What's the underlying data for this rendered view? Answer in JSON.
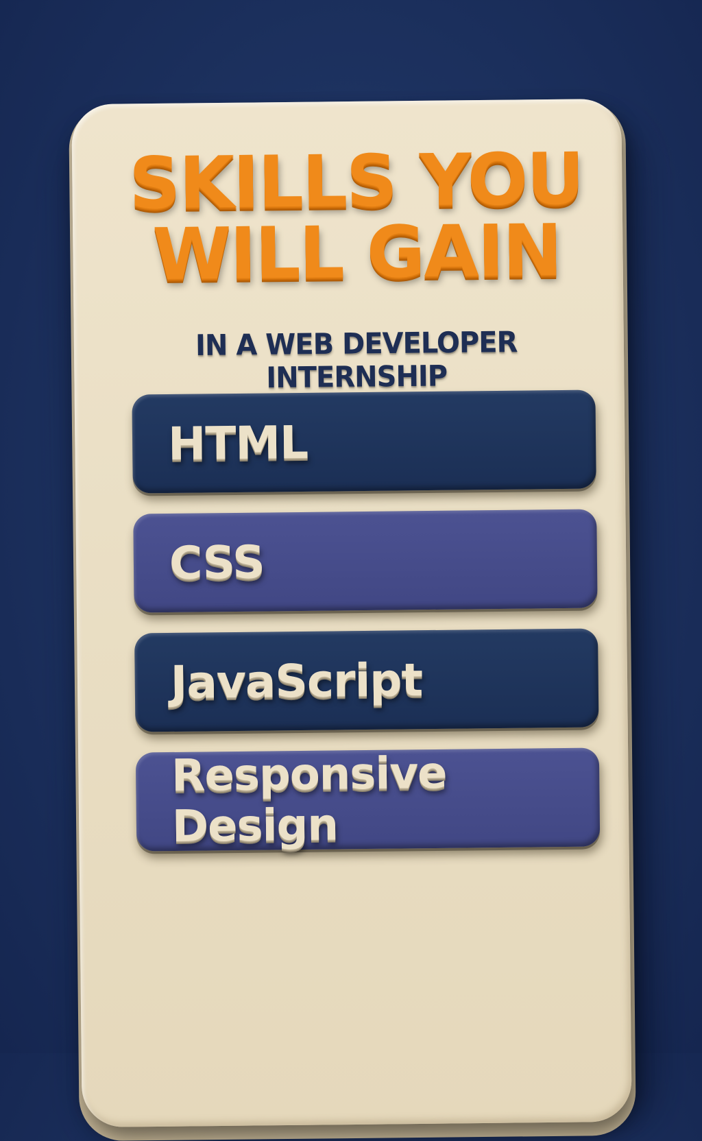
{
  "poster": {
    "title_line1": "SKILLS YOU",
    "title_line2": "WILL GAIN",
    "subtitle": "IN A WEB DEVELOPER INTERNSHIP",
    "skills": [
      {
        "label": "HTML",
        "style": "dark"
      },
      {
        "label": "CSS",
        "style": "light"
      },
      {
        "label": "JavaScript",
        "style": "dark"
      },
      {
        "label": "Responsive Design",
        "style": "light"
      }
    ]
  },
  "colors": {
    "background": "#1d3260",
    "card": "#eadfc5",
    "title": "#f08a1a",
    "subtitle": "#1e2e54",
    "skill_dark": "#1b2f55",
    "skill_light": "#434986",
    "skill_text": "#ece1c8"
  }
}
